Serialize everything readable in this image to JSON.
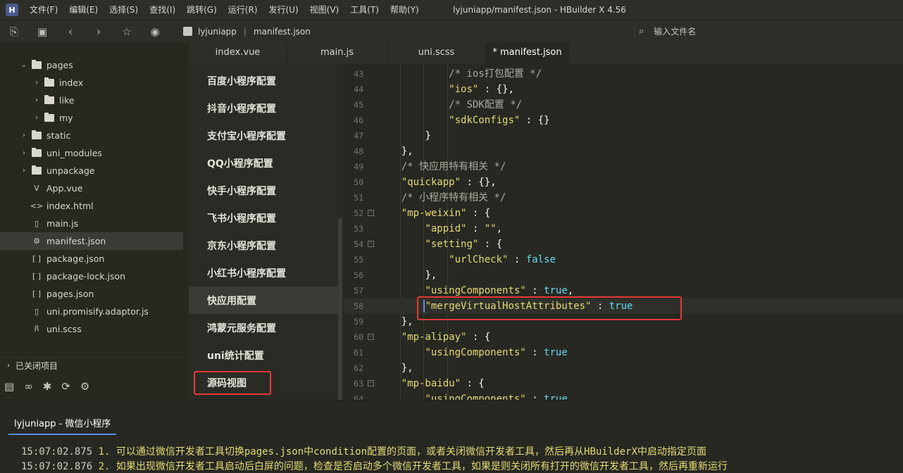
{
  "menubar": {
    "logo": "H",
    "items": [
      "文件(F)",
      "编辑(E)",
      "选择(S)",
      "查找(I)",
      "跳转(G)",
      "运行(R)",
      "发行(U)",
      "视图(V)",
      "工具(T)",
      "帮助(Y)"
    ],
    "title": "lyjuniapp/manifest.json - HBuilder X 4.56"
  },
  "toolbar": {
    "breadcrumb": [
      "lyjuniapp",
      "manifest.json"
    ],
    "file_search_placeholder": "输入文件名"
  },
  "sidebar": {
    "tree": [
      {
        "label": "pages",
        "type": "folder",
        "depth": 1,
        "expanded": true
      },
      {
        "label": "index",
        "type": "folder",
        "depth": 2,
        "expanded": false
      },
      {
        "label": "like",
        "type": "folder",
        "depth": 2,
        "expanded": false
      },
      {
        "label": "my",
        "type": "folder",
        "depth": 2,
        "expanded": false
      },
      {
        "label": "static",
        "type": "folder",
        "depth": 1,
        "expanded": false
      },
      {
        "label": "uni_modules",
        "type": "folder",
        "depth": 1,
        "expanded": false
      },
      {
        "label": "unpackage",
        "type": "folder",
        "depth": 1,
        "expanded": false
      },
      {
        "label": "App.vue",
        "type": "vue",
        "depth": 1
      },
      {
        "label": "index.html",
        "type": "html",
        "depth": 1
      },
      {
        "label": "main.js",
        "type": "file",
        "depth": 1
      },
      {
        "label": "manifest.json",
        "type": "gear",
        "depth": 1,
        "selected": true
      },
      {
        "label": "package.json",
        "type": "json",
        "depth": 1
      },
      {
        "label": "package-lock.json",
        "type": "json",
        "depth": 1
      },
      {
        "label": "pages.json",
        "type": "json",
        "depth": 1
      },
      {
        "label": "uni.promisify.adaptor.js",
        "type": "file",
        "depth": 1
      },
      {
        "label": "uni.scss",
        "type": "scss",
        "depth": 1
      }
    ],
    "closed_projects": "已关闭项目"
  },
  "tabs": [
    {
      "label": "index.vue",
      "active": false
    },
    {
      "label": "main.js",
      "active": false
    },
    {
      "label": "uni.scss",
      "active": false
    },
    {
      "label": "* manifest.json",
      "active": true
    }
  ],
  "config_panel": {
    "items": [
      {
        "label": "百度小程序配置"
      },
      {
        "label": "抖音小程序配置"
      },
      {
        "label": "支付宝小程序配置"
      },
      {
        "label": "QQ小程序配置"
      },
      {
        "label": "快手小程序配置"
      },
      {
        "label": "飞书小程序配置"
      },
      {
        "label": "京东小程序配置"
      },
      {
        "label": "小红书小程序配置"
      },
      {
        "label": "快应用配置",
        "active": true
      },
      {
        "label": "鸿蒙元服务配置"
      },
      {
        "label": "uni统计配置"
      },
      {
        "label": "源码视图",
        "highlighted": true
      }
    ]
  },
  "editor": {
    "lines": [
      {
        "n": "43",
        "indent": 3,
        "tokens": [
          [
            "c",
            "/* ios打包配置 */"
          ]
        ]
      },
      {
        "n": "44",
        "indent": 3,
        "tokens": [
          [
            "k",
            "\"ios\""
          ],
          [
            "p",
            " : {},"
          ]
        ]
      },
      {
        "n": "45",
        "indent": 3,
        "tokens": [
          [
            "c",
            "/* SDK配置 */"
          ]
        ]
      },
      {
        "n": "46",
        "indent": 3,
        "tokens": [
          [
            "k",
            "\"sdkConfigs\""
          ],
          [
            "p",
            " : {}"
          ]
        ]
      },
      {
        "n": "47",
        "indent": 2,
        "tokens": [
          [
            "p",
            "}"
          ]
        ]
      },
      {
        "n": "48",
        "indent": 1,
        "tokens": [
          [
            "p",
            "},"
          ]
        ]
      },
      {
        "n": "49",
        "indent": 1,
        "tokens": [
          [
            "c",
            "/* 快应用特有相关 */"
          ]
        ]
      },
      {
        "n": "50",
        "indent": 1,
        "tokens": [
          [
            "k",
            "\"quickapp\""
          ],
          [
            "p",
            " : {},"
          ]
        ]
      },
      {
        "n": "51",
        "indent": 1,
        "tokens": [
          [
            "c",
            "/* 小程序特有相关 */"
          ]
        ]
      },
      {
        "n": "52",
        "indent": 1,
        "fold": true,
        "tokens": [
          [
            "k",
            "\"mp-weixin\""
          ],
          [
            "p",
            " : {"
          ]
        ]
      },
      {
        "n": "53",
        "indent": 2,
        "tokens": [
          [
            "k",
            "\"appid\""
          ],
          [
            "p",
            " : "
          ],
          [
            "k",
            "\"\""
          ],
          [
            "p",
            ","
          ]
        ]
      },
      {
        "n": "54",
        "indent": 2,
        "fold": true,
        "tokens": [
          [
            "k",
            "\"setting\""
          ],
          [
            "p",
            " : {"
          ]
        ]
      },
      {
        "n": "55",
        "indent": 3,
        "tokens": [
          [
            "k",
            "\"urlCheck\""
          ],
          [
            "p",
            " : "
          ],
          [
            "b",
            "false"
          ]
        ]
      },
      {
        "n": "56",
        "indent": 2,
        "tokens": [
          [
            "p",
            "},"
          ]
        ]
      },
      {
        "n": "57",
        "indent": 2,
        "tokens": [
          [
            "k",
            "\"usingComponents\""
          ],
          [
            "p",
            " : "
          ],
          [
            "b",
            "true"
          ],
          [
            "p",
            ","
          ]
        ]
      },
      {
        "n": "58",
        "indent": 2,
        "current": true,
        "tokens": [
          [
            "k",
            "\"mergeVirtualHostAttributes\""
          ],
          [
            "p",
            " : "
          ],
          [
            "b",
            "true"
          ]
        ]
      },
      {
        "n": "59",
        "indent": 1,
        "tokens": [
          [
            "p",
            "},"
          ]
        ]
      },
      {
        "n": "60",
        "indent": 1,
        "fold": true,
        "tokens": [
          [
            "k",
            "\"mp-alipay\""
          ],
          [
            "p",
            " : {"
          ]
        ]
      },
      {
        "n": "61",
        "indent": 2,
        "tokens": [
          [
            "k",
            "\"usingComponents\""
          ],
          [
            "p",
            " : "
          ],
          [
            "b",
            "true"
          ]
        ]
      },
      {
        "n": "62",
        "indent": 1,
        "tokens": [
          [
            "p",
            "},"
          ]
        ]
      },
      {
        "n": "63",
        "indent": 1,
        "fold": true,
        "tokens": [
          [
            "k",
            "\"mp-baidu\""
          ],
          [
            "p",
            " : {"
          ]
        ]
      },
      {
        "n": "64",
        "indent": 2,
        "tokens": [
          [
            "k",
            "\"usingComponents\""
          ],
          [
            "p",
            " : "
          ],
          [
            "b",
            "true"
          ]
        ]
      }
    ]
  },
  "console": {
    "tab": "lyjuniapp - 微信小程序",
    "logs": [
      {
        "time": "15:07:02.875",
        "msg": "1. 可以通过微信开发者工具切换pages.json中condition配置的页面，或者关闭微信开发者工具，然后再从HBuilderX中启动指定页面"
      },
      {
        "time": "15:07:02.876",
        "msg": "2. 如果出现微信开发者工具启动后白屏的问题，检查是否启动多个微信开发者工具，如果是则关闭所有打开的微信开发者工具，然后再重新运行"
      }
    ]
  },
  "colors": {
    "accent": "#5a8adf",
    "highlight_box": "#e53935",
    "string": "#e6db74",
    "keyword": "#66d9ef",
    "comment": "#a9aaa0"
  }
}
